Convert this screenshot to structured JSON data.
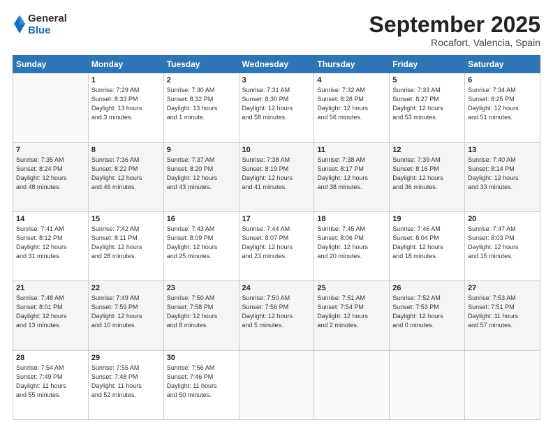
{
  "header": {
    "logo_general": "General",
    "logo_blue": "Blue",
    "month_title": "September 2025",
    "location": "Rocafort, Valencia, Spain"
  },
  "weekdays": [
    "Sunday",
    "Monday",
    "Tuesday",
    "Wednesday",
    "Thursday",
    "Friday",
    "Saturday"
  ],
  "weeks": [
    [
      {
        "day": "",
        "info": ""
      },
      {
        "day": "1",
        "info": "Sunrise: 7:29 AM\nSunset: 8:33 PM\nDaylight: 13 hours\nand 3 minutes."
      },
      {
        "day": "2",
        "info": "Sunrise: 7:30 AM\nSunset: 8:32 PM\nDaylight: 13 hours\nand 1 minute."
      },
      {
        "day": "3",
        "info": "Sunrise: 7:31 AM\nSunset: 8:30 PM\nDaylight: 12 hours\nand 58 minutes."
      },
      {
        "day": "4",
        "info": "Sunrise: 7:32 AM\nSunset: 8:28 PM\nDaylight: 12 hours\nand 56 minutes."
      },
      {
        "day": "5",
        "info": "Sunrise: 7:33 AM\nSunset: 8:27 PM\nDaylight: 12 hours\nand 53 minutes."
      },
      {
        "day": "6",
        "info": "Sunrise: 7:34 AM\nSunset: 8:25 PM\nDaylight: 12 hours\nand 51 minutes."
      }
    ],
    [
      {
        "day": "7",
        "info": "Sunrise: 7:35 AM\nSunset: 8:24 PM\nDaylight: 12 hours\nand 48 minutes."
      },
      {
        "day": "8",
        "info": "Sunrise: 7:36 AM\nSunset: 8:22 PM\nDaylight: 12 hours\nand 46 minutes."
      },
      {
        "day": "9",
        "info": "Sunrise: 7:37 AM\nSunset: 8:20 PM\nDaylight: 12 hours\nand 43 minutes."
      },
      {
        "day": "10",
        "info": "Sunrise: 7:38 AM\nSunset: 8:19 PM\nDaylight: 12 hours\nand 41 minutes."
      },
      {
        "day": "11",
        "info": "Sunrise: 7:38 AM\nSunset: 8:17 PM\nDaylight: 12 hours\nand 38 minutes."
      },
      {
        "day": "12",
        "info": "Sunrise: 7:39 AM\nSunset: 8:16 PM\nDaylight: 12 hours\nand 36 minutes."
      },
      {
        "day": "13",
        "info": "Sunrise: 7:40 AM\nSunset: 8:14 PM\nDaylight: 12 hours\nand 33 minutes."
      }
    ],
    [
      {
        "day": "14",
        "info": "Sunrise: 7:41 AM\nSunset: 8:12 PM\nDaylight: 12 hours\nand 31 minutes."
      },
      {
        "day": "15",
        "info": "Sunrise: 7:42 AM\nSunset: 8:11 PM\nDaylight: 12 hours\nand 28 minutes."
      },
      {
        "day": "16",
        "info": "Sunrise: 7:43 AM\nSunset: 8:09 PM\nDaylight: 12 hours\nand 25 minutes."
      },
      {
        "day": "17",
        "info": "Sunrise: 7:44 AM\nSunset: 8:07 PM\nDaylight: 12 hours\nand 23 minutes."
      },
      {
        "day": "18",
        "info": "Sunrise: 7:45 AM\nSunset: 8:06 PM\nDaylight: 12 hours\nand 20 minutes."
      },
      {
        "day": "19",
        "info": "Sunrise: 7:46 AM\nSunset: 8:04 PM\nDaylight: 12 hours\nand 18 minutes."
      },
      {
        "day": "20",
        "info": "Sunrise: 7:47 AM\nSunset: 8:03 PM\nDaylight: 12 hours\nand 15 minutes."
      }
    ],
    [
      {
        "day": "21",
        "info": "Sunrise: 7:48 AM\nSunset: 8:01 PM\nDaylight: 12 hours\nand 13 minutes."
      },
      {
        "day": "22",
        "info": "Sunrise: 7:49 AM\nSunset: 7:59 PM\nDaylight: 12 hours\nand 10 minutes."
      },
      {
        "day": "23",
        "info": "Sunrise: 7:50 AM\nSunset: 7:58 PM\nDaylight: 12 hours\nand 8 minutes."
      },
      {
        "day": "24",
        "info": "Sunrise: 7:50 AM\nSunset: 7:56 PM\nDaylight: 12 hours\nand 5 minutes."
      },
      {
        "day": "25",
        "info": "Sunrise: 7:51 AM\nSunset: 7:54 PM\nDaylight: 12 hours\nand 2 minutes."
      },
      {
        "day": "26",
        "info": "Sunrise: 7:52 AM\nSunset: 7:53 PM\nDaylight: 12 hours\nand 0 minutes."
      },
      {
        "day": "27",
        "info": "Sunrise: 7:53 AM\nSunset: 7:51 PM\nDaylight: 11 hours\nand 57 minutes."
      }
    ],
    [
      {
        "day": "28",
        "info": "Sunrise: 7:54 AM\nSunset: 7:49 PM\nDaylight: 11 hours\nand 55 minutes."
      },
      {
        "day": "29",
        "info": "Sunrise: 7:55 AM\nSunset: 7:48 PM\nDaylight: 11 hours\nand 52 minutes."
      },
      {
        "day": "30",
        "info": "Sunrise: 7:56 AM\nSunset: 7:46 PM\nDaylight: 11 hours\nand 50 minutes."
      },
      {
        "day": "",
        "info": ""
      },
      {
        "day": "",
        "info": ""
      },
      {
        "day": "",
        "info": ""
      },
      {
        "day": "",
        "info": ""
      }
    ]
  ]
}
